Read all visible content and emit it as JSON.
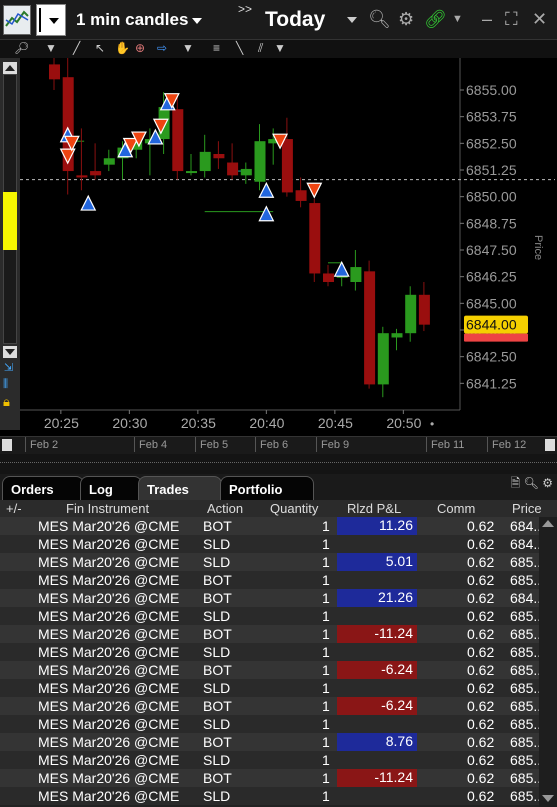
{
  "toolbar": {
    "interval": "1 min candles",
    "arrows": ">>",
    "period": "Today"
  },
  "price_label": "Price",
  "current_price": "6844.00",
  "tabs": [
    {
      "label": "Orders"
    },
    {
      "label": "Log"
    },
    {
      "label": "Trades"
    },
    {
      "label": "Portfolio"
    }
  ],
  "timeline": {
    "labels": [
      "Feb 2",
      "Feb 4",
      "Feb 5",
      "Feb 6",
      "Feb 9",
      "Feb 11",
      "Feb 12"
    ]
  },
  "table": {
    "columns": [
      "+/-",
      "Fin Instrument",
      "Action",
      "Quantity",
      "Rlzd P&L",
      "Comm",
      "Price"
    ],
    "rows": [
      {
        "instrument": "MES Mar20'26 @CME",
        "action": "BOT",
        "qty": "1",
        "pnl": "11.26",
        "comm": "0.62",
        "price": "684..."
      },
      {
        "instrument": "MES Mar20'26 @CME",
        "action": "SLD",
        "qty": "1",
        "pnl": "",
        "comm": "0.62",
        "price": "684..."
      },
      {
        "instrument": "MES Mar20'26 @CME",
        "action": "SLD",
        "qty": "1",
        "pnl": "5.01",
        "comm": "0.62",
        "price": "685..."
      },
      {
        "instrument": "MES Mar20'26 @CME",
        "action": "BOT",
        "qty": "1",
        "pnl": "",
        "comm": "0.62",
        "price": "685..."
      },
      {
        "instrument": "MES Mar20'26 @CME",
        "action": "BOT",
        "qty": "1",
        "pnl": "21.26",
        "comm": "0.62",
        "price": "684..."
      },
      {
        "instrument": "MES Mar20'26 @CME",
        "action": "SLD",
        "qty": "1",
        "pnl": "",
        "comm": "0.62",
        "price": "685..."
      },
      {
        "instrument": "MES Mar20'26 @CME",
        "action": "BOT",
        "qty": "1",
        "pnl": "-11.24",
        "comm": "0.62",
        "price": "685..."
      },
      {
        "instrument": "MES Mar20'26 @CME",
        "action": "SLD",
        "qty": "1",
        "pnl": "",
        "comm": "0.62",
        "price": "685..."
      },
      {
        "instrument": "MES Mar20'26 @CME",
        "action": "BOT",
        "qty": "1",
        "pnl": "-6.24",
        "comm": "0.62",
        "price": "685..."
      },
      {
        "instrument": "MES Mar20'26 @CME",
        "action": "SLD",
        "qty": "1",
        "pnl": "",
        "comm": "0.62",
        "price": "685..."
      },
      {
        "instrument": "MES Mar20'26 @CME",
        "action": "BOT",
        "qty": "1",
        "pnl": "-6.24",
        "comm": "0.62",
        "price": "685..."
      },
      {
        "instrument": "MES Mar20'26 @CME",
        "action": "SLD",
        "qty": "1",
        "pnl": "",
        "comm": "0.62",
        "price": "685..."
      },
      {
        "instrument": "MES Mar20'26 @CME",
        "action": "BOT",
        "qty": "1",
        "pnl": "8.76",
        "comm": "0.62",
        "price": "685..."
      },
      {
        "instrument": "MES Mar20'26 @CME",
        "action": "SLD",
        "qty": "1",
        "pnl": "",
        "comm": "0.62",
        "price": "685..."
      },
      {
        "instrument": "MES Mar20'26 @CME",
        "action": "BOT",
        "qty": "1",
        "pnl": "-11.24",
        "comm": "0.62",
        "price": "685..."
      },
      {
        "instrument": "MES Mar20'26 @CME",
        "action": "SLD",
        "qty": "1",
        "pnl": "",
        "comm": "0.62",
        "price": "685..."
      }
    ]
  },
  "colors": {
    "up": "#2a9a1e",
    "down": "#9a0e0e",
    "buy_marker": "#2266dd",
    "sell_marker": "#ee4411",
    "current_price_bg": "#f5d000",
    "pnl_positive": "#1e2a9a",
    "pnl_negative": "#8a1616"
  },
  "chart_data": {
    "type": "candlestick",
    "ylabel": "Price",
    "y_ticks": [
      6855.0,
      6853.75,
      6852.5,
      6851.25,
      6850.0,
      6848.75,
      6847.5,
      6846.25,
      6845.0,
      6843.75,
      6842.5,
      6841.25
    ],
    "x_ticks": [
      "20:25",
      "20:30",
      "20:35",
      "20:40",
      "20:45",
      "20:50"
    ],
    "ylim": [
      6840.0,
      6856.5
    ],
    "last_price": 6844.0,
    "reference_line": 6850.8,
    "candles": [
      {
        "t": 0,
        "o": 6856.2,
        "h": 6857.0,
        "l": 6855.0,
        "c": 6855.5
      },
      {
        "t": 1,
        "o": 6855.6,
        "h": 6856.5,
        "l": 6850.1,
        "c": 6851.2
      },
      {
        "t": 2,
        "o": 6851.0,
        "h": 6853.2,
        "l": 6850.3,
        "c": 6850.9
      },
      {
        "t": 3,
        "o": 6851.2,
        "h": 6852.5,
        "l": 6850.8,
        "c": 6851.0
      },
      {
        "t": 4,
        "o": 6851.5,
        "h": 6852.2,
        "l": 6851.2,
        "c": 6851.8
      },
      {
        "t": 5,
        "o": 6851.8,
        "h": 6852.6,
        "l": 6850.8,
        "c": 6852.3
      },
      {
        "t": 6,
        "o": 6852.2,
        "h": 6852.8,
        "l": 6851.8,
        "c": 6852.6
      },
      {
        "t": 7,
        "o": 6852.5,
        "h": 6853.2,
        "l": 6851.0,
        "c": 6852.7
      },
      {
        "t": 8,
        "o": 6852.7,
        "h": 6854.9,
        "l": 6852.0,
        "c": 6854.2
      },
      {
        "t": 9,
        "o": 6854.1,
        "h": 6854.8,
        "l": 6850.8,
        "c": 6851.2
      },
      {
        "t": 10,
        "o": 6851.2,
        "h": 6852.0,
        "l": 6851.0,
        "c": 6851.2
      },
      {
        "t": 11,
        "o": 6851.2,
        "h": 6852.9,
        "l": 6850.9,
        "c": 6852.1
      },
      {
        "t": 12,
        "o": 6852.0,
        "h": 6852.6,
        "l": 6851.3,
        "c": 6851.8
      },
      {
        "t": 13,
        "o": 6851.6,
        "h": 6852.5,
        "l": 6850.8,
        "c": 6851.0
      },
      {
        "t": 14,
        "o": 6851.0,
        "h": 6851.6,
        "l": 6850.6,
        "c": 6851.3
      },
      {
        "t": 15,
        "o": 6850.7,
        "h": 6853.4,
        "l": 6850.3,
        "c": 6852.6
      },
      {
        "t": 16,
        "o": 6852.5,
        "h": 6853.2,
        "l": 6851.5,
        "c": 6852.7
      },
      {
        "t": 17,
        "o": 6852.7,
        "h": 6853.7,
        "l": 6850.0,
        "c": 6850.2
      },
      {
        "t": 18,
        "o": 6850.3,
        "h": 6850.9,
        "l": 6849.5,
        "c": 6849.8
      },
      {
        "t": 19,
        "o": 6849.7,
        "h": 6849.9,
        "l": 6846.0,
        "c": 6846.4
      },
      {
        "t": 20,
        "o": 6846.4,
        "h": 6846.8,
        "l": 6845.8,
        "c": 6846.0
      },
      {
        "t": 21,
        "o": 6846.2,
        "h": 6846.5,
        "l": 6845.8,
        "c": 6846.3
      },
      {
        "t": 22,
        "o": 6846.0,
        "h": 6847.5,
        "l": 6845.6,
        "c": 6846.7
      },
      {
        "t": 23,
        "o": 6846.5,
        "h": 6847.0,
        "l": 6841.0,
        "c": 6841.2
      },
      {
        "t": 24,
        "o": 6841.2,
        "h": 6843.9,
        "l": 6840.6,
        "c": 6843.6
      },
      {
        "t": 25,
        "o": 6843.4,
        "h": 6843.8,
        "l": 6842.8,
        "c": 6843.6
      },
      {
        "t": 26,
        "o": 6843.6,
        "h": 6845.8,
        "l": 6843.2,
        "c": 6845.4
      },
      {
        "t": 27,
        "o": 6845.4,
        "h": 6846.0,
        "l": 6843.7,
        "c": 6844.0
      }
    ],
    "trade_markers": [
      {
        "t": 1.0,
        "p": 6852.9,
        "side": "buy"
      },
      {
        "t": 1.0,
        "p": 6851.9,
        "side": "sell"
      },
      {
        "t": 1.3,
        "p": 6852.5,
        "side": "sell"
      },
      {
        "t": 2.5,
        "p": 6849.7,
        "side": "buy"
      },
      {
        "t": 5.2,
        "p": 6852.2,
        "side": "buy"
      },
      {
        "t": 5.6,
        "p": 6852.4,
        "side": "sell"
      },
      {
        "t": 6.2,
        "p": 6852.7,
        "side": "sell"
      },
      {
        "t": 7.4,
        "p": 6852.8,
        "side": "buy"
      },
      {
        "t": 7.8,
        "p": 6853.3,
        "side": "sell"
      },
      {
        "t": 8.3,
        "p": 6854.4,
        "side": "buy"
      },
      {
        "t": 8.6,
        "p": 6854.5,
        "side": "sell"
      },
      {
        "t": 15.5,
        "p": 6850.3,
        "side": "buy"
      },
      {
        "t": 15.5,
        "p": 6849.2,
        "side": "buy"
      },
      {
        "t": 16.5,
        "p": 6852.6,
        "side": "sell"
      },
      {
        "t": 19.0,
        "p": 6850.3,
        "side": "sell"
      },
      {
        "t": 21.0,
        "p": 6846.6,
        "side": "buy"
      }
    ],
    "level_lines": [
      {
        "t0": 1.2,
        "t1": 2.2,
        "p": 6852.6,
        "color": "#2a9a1e"
      },
      {
        "t0": 11.0,
        "t1": 16.0,
        "p": 6849.3,
        "color": "#2a9a1e"
      },
      {
        "t0": 20.0,
        "t1": 21.0,
        "p": 6846.9,
        "color": "#2a9a1e"
      },
      {
        "t0": 13.0,
        "t1": 14.0,
        "p": 6851.2,
        "color": "#16a3a3"
      }
    ]
  }
}
